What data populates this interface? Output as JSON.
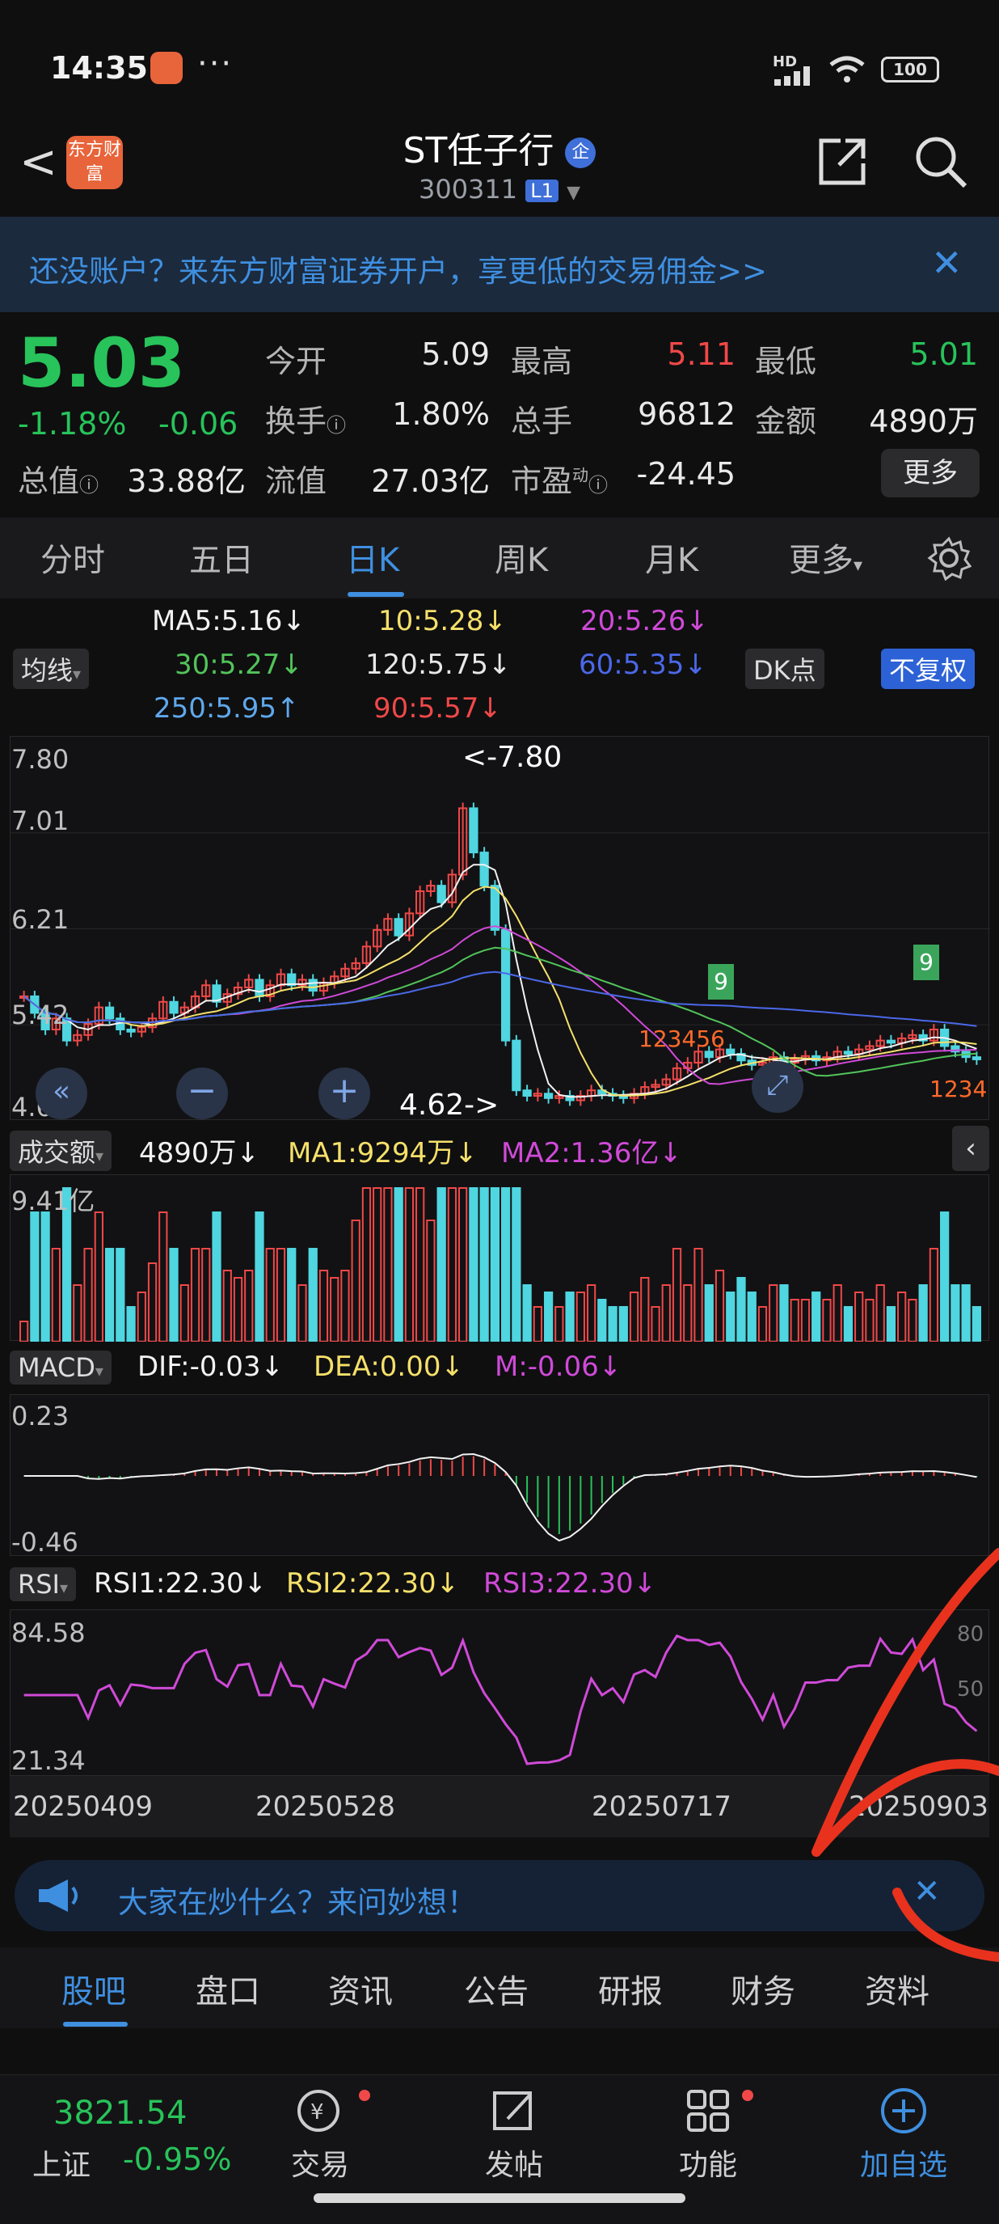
{
  "status": {
    "time": "14:35",
    "dots": "···",
    "network": "HD",
    "battery": "100"
  },
  "header": {
    "back": "<",
    "logo": "东方财富",
    "title": "ST任子行",
    "badge": "企",
    "code": "300311",
    "level": "L1"
  },
  "ad": {
    "text": "还没账户？来东方财富证券开户，享更低的交易佣金>>"
  },
  "quote": {
    "price": "5.03",
    "change_pct": "-1.18%",
    "change": "-0.06",
    "open_label": "今开",
    "open": "5.09",
    "high_label": "最高",
    "high": "5.11",
    "low_label": "最低",
    "low": "5.01",
    "turnover_label": "换手",
    "turnover": "1.80%",
    "volume_label": "总手",
    "volume": "96812",
    "amount_label": "金额",
    "amount": "4890万",
    "mcap_label": "总值",
    "mcap": "33.88亿",
    "float_label": "流值",
    "float": "27.03亿",
    "pe_label": "市盈",
    "pe_sup": "动",
    "pe": "-24.45",
    "more": "更多"
  },
  "tabs": [
    "分时",
    "五日",
    "日K",
    "周K",
    "月K",
    "更多"
  ],
  "ma": {
    "selector": "均线",
    "ma5": "MA5:5.16↓",
    "ma10": "10:5.28↓",
    "ma20": "20:5.26↓",
    "ma30": "30:5.27↓",
    "ma120": "120:5.75↓",
    "ma60": "60:5.35↓",
    "ma250": "250:5.95↑",
    "ma90": "90:5.57↓",
    "dk": "DK点",
    "fuquan": "不复权"
  },
  "kline": {
    "y_top": "7.80",
    "y2": "7.01",
    "y3": "6.21",
    "y4": "5.42",
    "y_bottom": "4.62",
    "max_label": "<-7.80",
    "min_label": "4.62->",
    "nine_a": "9",
    "nine_b": "9",
    "digits_a": "123456",
    "digits_b": "1234"
  },
  "volume": {
    "selector": "成交额",
    "value": "4890万↓",
    "ma1": "MA1:9294万↓",
    "ma2": "MA2:1.36亿↓",
    "y_top": "9.41亿"
  },
  "macd": {
    "selector": "MACD",
    "dif": "DIF:-0.03↓",
    "dea": "DEA:0.00↓",
    "m": "M:-0.06↓",
    "y_top": "0.23",
    "y_bottom": "-0.46"
  },
  "rsi": {
    "selector": "RSI",
    "rsi1": "RSI1:22.30↓",
    "rsi2": "RSI2:22.30↓",
    "rsi3": "RSI3:22.30↓",
    "y_top": "84.58",
    "y_bottom": "21.34",
    "r80": "80",
    "r50": "50"
  },
  "dates": [
    "20250409",
    "20250528",
    "20250717",
    "20250903"
  ],
  "ask": {
    "text": "大家在炒什么？来问妙想！"
  },
  "subtabs": [
    "股吧",
    "盘口",
    "资讯",
    "公告",
    "研报",
    "财务",
    "资料"
  ],
  "bottom": {
    "index_value": "3821.54",
    "index_name": "上证",
    "index_change": "-0.95%",
    "trade": "交易",
    "post": "发帖",
    "func": "功能",
    "add": "加自选"
  },
  "colors": {
    "up": "#f04848",
    "down": "#28c35a",
    "accent": "#3f8fe0"
  },
  "chart_data": {
    "type": "candlestick",
    "ylim": [
      4.62,
      7.8
    ],
    "closes": [
      5.6,
      5.45,
      5.3,
      5.4,
      5.2,
      5.25,
      5.35,
      5.5,
      5.4,
      5.3,
      5.28,
      5.32,
      5.4,
      5.55,
      5.45,
      5.5,
      5.6,
      5.7,
      5.55,
      5.62,
      5.68,
      5.75,
      5.6,
      5.7,
      5.8,
      5.7,
      5.75,
      5.65,
      5.72,
      5.78,
      5.85,
      5.9,
      6.05,
      6.2,
      6.3,
      6.15,
      6.35,
      6.55,
      6.6,
      6.45,
      6.7,
      7.3,
      6.9,
      6.6,
      6.2,
      5.2,
      4.75,
      4.7,
      4.72,
      4.68,
      4.7,
      4.66,
      4.7,
      4.75,
      4.72,
      4.7,
      4.68,
      4.72,
      4.78,
      4.8,
      4.85,
      4.95,
      5.0,
      5.1,
      5.05,
      5.12,
      5.08,
      5.02,
      4.98,
      5.0,
      5.05,
      5.0,
      5.03,
      5.06,
      5.02,
      5.05,
      5.1,
      5.08,
      5.12,
      5.15,
      5.2,
      5.18,
      5.22,
      5.25,
      5.2,
      5.3,
      5.15,
      5.1,
      5.05,
      5.03
    ]
  }
}
